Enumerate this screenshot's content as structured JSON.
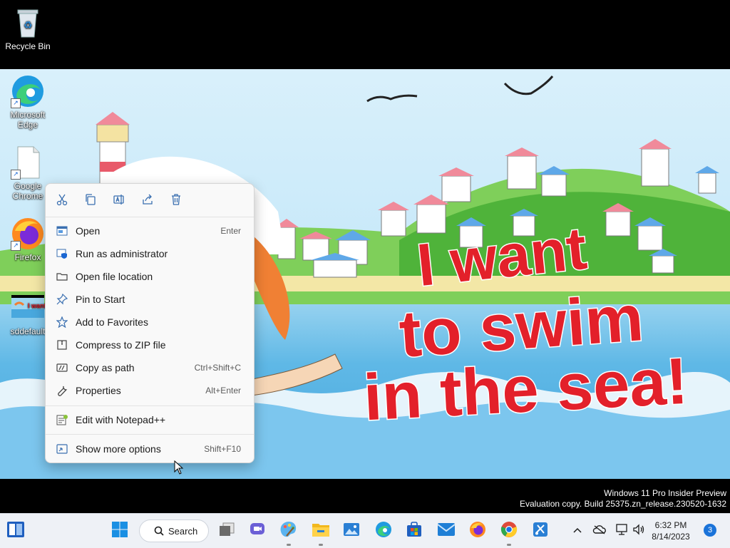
{
  "desktop": {
    "icons": [
      {
        "label": "Recycle Bin",
        "icon": "recycle-bin-icon"
      },
      {
        "label": "Microsoft Edge",
        "icon": "edge-icon"
      },
      {
        "label": "Google Chrome",
        "icon": "file-icon"
      },
      {
        "label": "Firefox",
        "icon": "firefox-icon"
      },
      {
        "label": "sddefault",
        "icon": "image-thumbnail-icon"
      }
    ]
  },
  "wallpaper": {
    "lines": [
      "I want",
      "to swim",
      "in the sea!"
    ],
    "text_color": "#e3202a"
  },
  "context_menu": {
    "toolbar": [
      {
        "icon": "cut-icon"
      },
      {
        "icon": "copy-icon"
      },
      {
        "icon": "rename-icon"
      },
      {
        "icon": "share-icon"
      },
      {
        "icon": "delete-icon"
      }
    ],
    "items": [
      {
        "label": "Open",
        "shortcut": "Enter",
        "icon": "open-icon"
      },
      {
        "label": "Run as administrator",
        "shortcut": "",
        "icon": "shield-icon"
      },
      {
        "label": "Open file location",
        "shortcut": "",
        "icon": "folder-icon"
      },
      {
        "label": "Pin to Start",
        "shortcut": "",
        "icon": "pin-icon"
      },
      {
        "label": "Add to Favorites",
        "shortcut": "",
        "icon": "star-icon"
      },
      {
        "label": "Compress to ZIP file",
        "shortcut": "",
        "icon": "zip-icon"
      },
      {
        "label": "Copy as path",
        "shortcut": "Ctrl+Shift+C",
        "icon": "path-icon"
      },
      {
        "label": "Properties",
        "shortcut": "Alt+Enter",
        "icon": "wrench-icon"
      }
    ],
    "notepad_item": {
      "label": "Edit with Notepad++",
      "icon": "notepad-plus-icon"
    },
    "more_options": {
      "label": "Show more options",
      "shortcut": "Shift+F10",
      "icon": "more-options-icon"
    }
  },
  "watermark": {
    "line1": "Windows 11 Pro Insider Preview",
    "line2": "Evaluation copy. Build 25375.zn_release.230520-1632"
  },
  "taskbar": {
    "search_label": "Search",
    "apps": [
      {
        "icon": "widgets-icon"
      },
      {
        "icon": "start-icon"
      },
      {
        "icon": "task-view-icon"
      },
      {
        "icon": "teams-chat-icon"
      },
      {
        "icon": "paint-icon"
      },
      {
        "icon": "file-explorer-icon"
      },
      {
        "icon": "photos-icon"
      },
      {
        "icon": "edge-icon"
      },
      {
        "icon": "store-icon"
      },
      {
        "icon": "mail-icon"
      },
      {
        "icon": "firefox-icon"
      },
      {
        "icon": "chrome-icon"
      },
      {
        "icon": "snipping-tool-icon"
      }
    ],
    "tray": {
      "icons": [
        "chevron-up-icon",
        "cloud-icon",
        "network-icon",
        "volume-icon"
      ],
      "time": "6:32 PM",
      "date": "8/14/2023",
      "notification_count": "3"
    }
  },
  "colors": {
    "taskbar_bg": "#eef1f6",
    "menu_bg": "#f9f9f9",
    "accent": "#1a73d9"
  }
}
